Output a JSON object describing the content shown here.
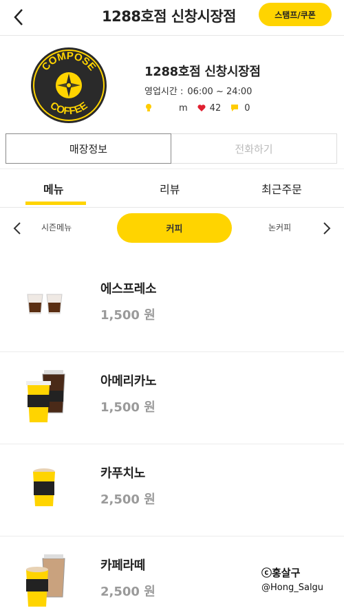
{
  "header": {
    "title": "1288호점 신창시장점",
    "stamp_coupon": "스탬프/쿠폰"
  },
  "store": {
    "name": "1288호점 신창시장점",
    "hours_label": "영업시간 :",
    "hours_value": "06:00 ~ 24:00",
    "stat_m": "m",
    "likes": "42",
    "reviews": "0",
    "logo_top": "COMPOSE",
    "logo_bottom": "COFFEE"
  },
  "info_tabs": [
    "매장정보",
    "전화하기"
  ],
  "main_tabs": [
    "메뉴",
    "리뷰",
    "최근주문"
  ],
  "categories": {
    "left": "시즌메뉴",
    "active": "커피",
    "right": "논커피"
  },
  "menu": [
    {
      "name": "에스프레소",
      "price": "1,500 원"
    },
    {
      "name": "아메리카노",
      "price": "1,500 원"
    },
    {
      "name": "카푸치노",
      "price": "2,500 원"
    },
    {
      "name": "카페라떼",
      "price": "2,500 원"
    }
  ],
  "watermark": {
    "line1": "ⓒ홍살구",
    "line2": "@Hong_Salgu"
  },
  "colors": {
    "accent": "#ffd400",
    "price_gray": "#9a9a9a",
    "heart": "#e02030"
  }
}
